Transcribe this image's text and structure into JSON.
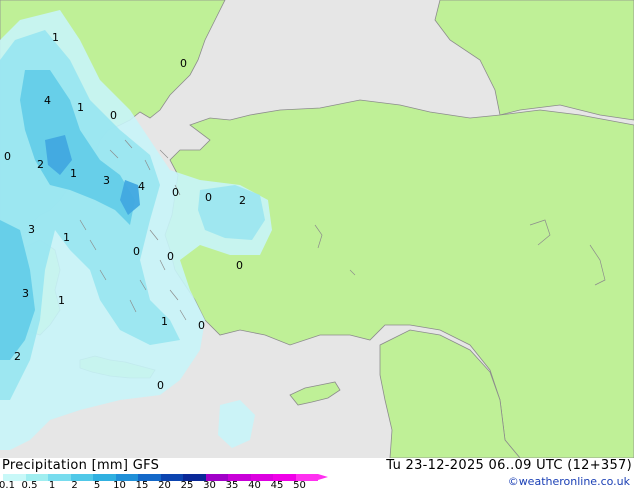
{
  "map": {
    "colors": {
      "sea": "#e6e6e6",
      "land": "#bff097",
      "precip_light": "#c8f4f8",
      "precip_mid": "#9ae6f0",
      "precip_heavy": "#64cde8",
      "precip_strong": "#41a8e0",
      "border": "#8c8c8c"
    },
    "value_labels": [
      "1",
      "4",
      "1",
      "0",
      "0",
      "2",
      "1",
      "3",
      "4",
      "0",
      "0",
      "2",
      "3",
      "1",
      "0",
      "0",
      "0",
      "3",
      "1",
      "1",
      "0",
      "2",
      "0",
      "0"
    ]
  },
  "footer": {
    "title": "Precipitation [mm]  GFS",
    "run": "Tu 23-12-2025 06..09 UTC (12+357)",
    "credit": "©weatheronline.co.uk",
    "colorbar": [
      {
        "label": "0.1",
        "color": "#c8f8f8"
      },
      {
        "label": "0.5",
        "color": "#a0eef0"
      },
      {
        "label": "1",
        "color": "#78dcee"
      },
      {
        "label": "2",
        "color": "#50c8e8"
      },
      {
        "label": "5",
        "color": "#30b0e0"
      },
      {
        "label": "10",
        "color": "#2090d8"
      },
      {
        "label": "15",
        "color": "#1468c8"
      },
      {
        "label": "20",
        "color": "#0c44b0"
      },
      {
        "label": "25",
        "color": "#0a2898"
      },
      {
        "label": "30",
        "color": "#a000c8"
      },
      {
        "label": "35",
        "color": "#c800d8"
      },
      {
        "label": "40",
        "color": "#dc00e0"
      },
      {
        "label": "45",
        "color": "#f000e8"
      },
      {
        "label": "50",
        "color": "#ff30f0"
      }
    ]
  }
}
